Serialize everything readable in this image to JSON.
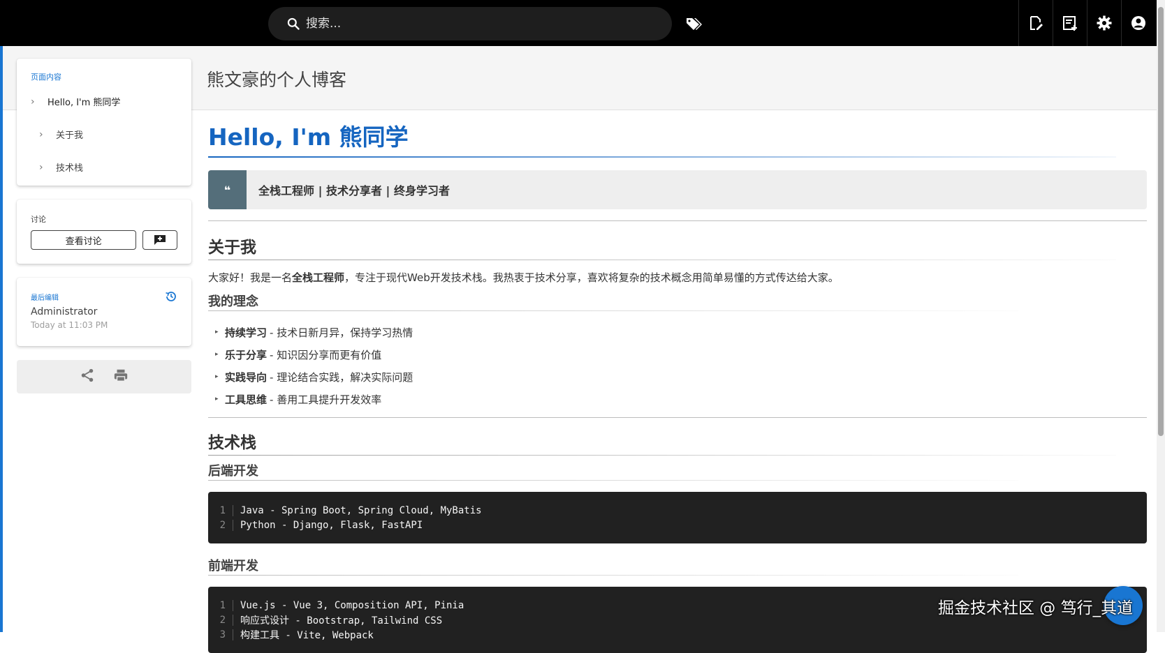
{
  "search": {
    "placeholder": "搜索..."
  },
  "page": {
    "title": "熊文豪的个人博客"
  },
  "toc": {
    "heading": "页面内容",
    "items": [
      {
        "label": "Hello, I'm 熊同学"
      },
      {
        "label": "关于我"
      },
      {
        "label": "技术栈"
      }
    ]
  },
  "discussion": {
    "heading": "讨论",
    "view_label": "查看讨论"
  },
  "last_edit": {
    "heading": "最后编辑",
    "user": "Administrator",
    "time": "Today at 11:03 PM"
  },
  "article": {
    "h1": "Hello, I'm 熊同学",
    "quote": "全栈工程师 | 技术分享者 | 终身学习者",
    "about_heading": "关于我",
    "intro_pre": "大家好！我是一名",
    "intro_bold": "全栈工程师",
    "intro_post": "，专注于现代Web开发技术栈。我热衷于技术分享，喜欢将复杂的技术概念用简单易懂的方式传达给大家。",
    "philosophy_heading": "我的理念",
    "philosophy": [
      {
        "bold": "持续学习",
        "text": "- 技术日新月异，保持学习热情"
      },
      {
        "bold": "乐于分享",
        "text": "- 知识因分享而更有价值"
      },
      {
        "bold": "实践导向",
        "text": "- 理论结合实践，解决实际问题"
      },
      {
        "bold": "工具思维",
        "text": "- 善用工具提升开发效率"
      }
    ],
    "stack_heading": "技术栈",
    "backend_heading": "后端开发",
    "backend_code": [
      {
        "n": "1",
        "code": "Java - Spring Boot, Spring Cloud, MyBatis"
      },
      {
        "n": "2",
        "code": "Python - Django, Flask, FastAPI"
      }
    ],
    "frontend_heading": "前端开发",
    "frontend_code": [
      {
        "n": "1",
        "code": "Vue.js - Vue 3, Composition API, Pinia"
      },
      {
        "n": "2",
        "code": "响应式设计 - Bootstrap, Tailwind CSS"
      },
      {
        "n": "3",
        "code": "构建工具 - Vite, Webpack"
      }
    ]
  },
  "watermark": "掘金技术社区 @ 笃行_其道",
  "colors": {
    "accent": "#1976d2",
    "topbar": "#000000",
    "code_bg": "#212121"
  }
}
